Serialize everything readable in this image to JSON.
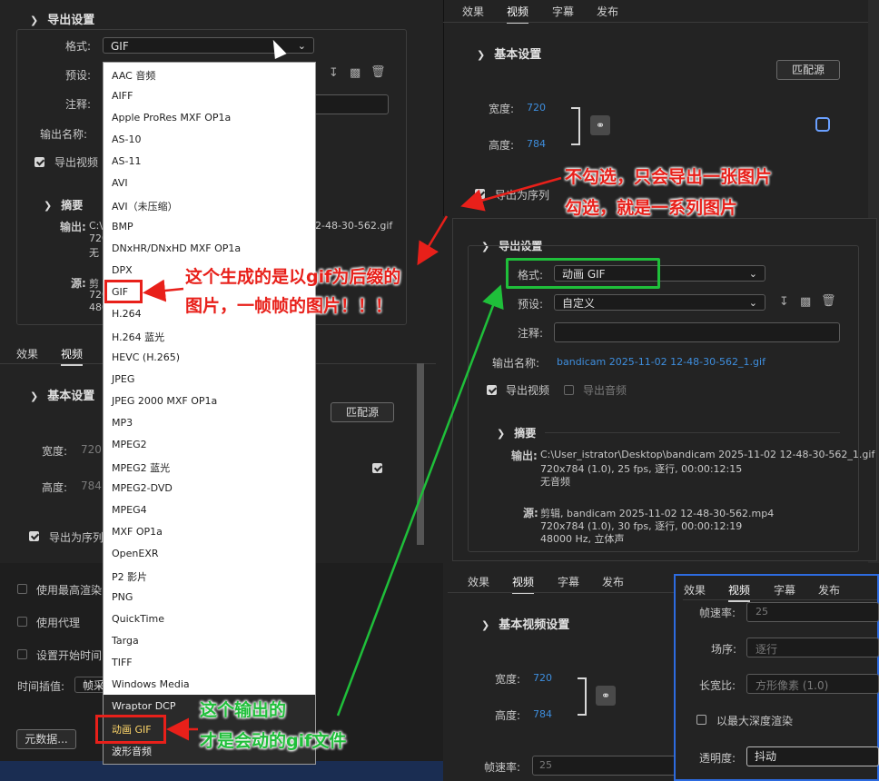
{
  "left_panel": {
    "export_settings_title": "导出设置",
    "format_label": "格式:",
    "format_value": "GIF",
    "preset_label": "预设:",
    "comment_label": "注释:",
    "output_name_label": "输出名称:",
    "export_video_label": "导出视频",
    "summary_title": "摘要",
    "output_label": "输出:",
    "output_line1_prefix": "C:\\",
    "output_line1_suffix": "2-48-30-562.gif",
    "output_line2": "720",
    "output_line3": "无",
    "source_label": "源:",
    "source_line1": "剪",
    "source_line2": "720",
    "source_line3": "480",
    "tabs": [
      "效果",
      "视频"
    ],
    "basic_settings_title": "基本设置",
    "match_source_button": "匹配源",
    "width_label": "宽度:",
    "width_value": "720",
    "height_label": "高度:",
    "height_value": "784",
    "export_sequence_label": "导出为序列",
    "use_max_render_label": "使用最高渲染",
    "use_proxy_label": "使用代理",
    "set_start_time_label": "设置开始时间",
    "time_interp_label": "时间插值:",
    "time_interp_value": "帧采",
    "metadata_button": "元数据..."
  },
  "format_dropdown": {
    "items": [
      "AAC 音频",
      "AIFF",
      "Apple ProRes MXF OP1a",
      "AS-10",
      "AS-11",
      "AVI",
      "AVI（未压缩）",
      "BMP",
      "DNxHR/DNxHD MXF OP1a",
      "DPX",
      "GIF",
      "H.264",
      "H.264 蓝光",
      "HEVC (H.265)",
      "JPEG",
      "JPEG 2000 MXF OP1a",
      "MP3",
      "MPEG2",
      "MPEG2 蓝光",
      "MPEG2-DVD",
      "MPEG4",
      "MXF OP1a",
      "OpenEXR",
      "P2 影片",
      "PNG",
      "QuickTime",
      "Targa",
      "TIFF",
      "Windows Media",
      "Wraptor DCP",
      "动画 GIF",
      "波形音频"
    ]
  },
  "right_top": {
    "tabs": [
      "效果",
      "视频",
      "字幕",
      "发布"
    ],
    "basic_settings_title": "基本设置",
    "match_source_button": "匹配源",
    "width_label": "宽度:",
    "width_value": "720",
    "height_label": "高度:",
    "height_value": "784",
    "export_sequence_label": "导出为序列"
  },
  "right_middle": {
    "export_settings_title": "导出设置",
    "format_label": "格式:",
    "format_value": "动画 GIF",
    "preset_label": "预设:",
    "preset_value": "自定义",
    "comment_label": "注释:",
    "output_name_label": "输出名称:",
    "output_name_value": "bandicam 2025-11-02 12-48-30-562_1.gif",
    "export_video_label": "导出视频",
    "export_audio_label": "导出音频",
    "summary_title": "摘要",
    "output_label": "输出:",
    "output_line1": "C:\\User_istrator\\Desktop\\bandicam 2025-11-02 12-48-30-562_1.gif",
    "output_line2": "720x784 (1.0), 25 fps, 逐行, 00:00:12:15",
    "output_line3": "无音频",
    "source_label": "源:",
    "source_line1": "剪辑, bandicam 2025-11-02 12-48-30-562.mp4",
    "source_line2": "720x784 (1.0), 30 fps, 逐行, 00:00:12:19",
    "source_line3": "48000 Hz, 立体声"
  },
  "right_bottom": {
    "tabs": [
      "效果",
      "视频",
      "字幕",
      "发布"
    ],
    "basic_video_title": "基本视频设置",
    "width_label": "宽度:",
    "width_value": "720",
    "height_label": "高度:",
    "height_value": "784",
    "frame_rate_label": "帧速率:",
    "frame_rate_value": "25"
  },
  "right_popup": {
    "tabs": [
      "效果",
      "视频",
      "字幕",
      "发布"
    ],
    "frame_rate_label": "帧速率:",
    "frame_rate_value": "25",
    "field_order_label": "场序:",
    "field_order_value": "逐行",
    "aspect_label": "长宽比:",
    "aspect_value": "方形像素 (1.0)",
    "max_depth_label": "以最大深度渲染",
    "transparency_label": "透明度:",
    "transparency_value": "抖动"
  },
  "annotations": {
    "red_right_line1": "不勾选，只会导出一张图片",
    "red_right_line2": "勾选，就是一系列图片",
    "red_mid_line1": "这个生成的是以gif为后缀的",
    "red_mid_line2": "图片，一帧帧的图片！！！",
    "green_line1": "这个输出的",
    "green_line2": "才是会动的gif文件"
  },
  "colors": {
    "panel_bg": "#232323",
    "link_blue": "#3e8ede",
    "annotation_red": "#e8201a",
    "annotation_green": "#1fbf3a"
  }
}
